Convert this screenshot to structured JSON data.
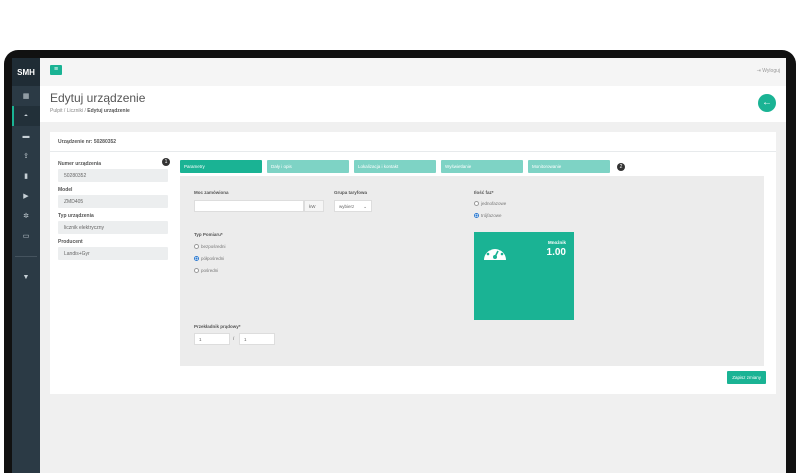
{
  "app": {
    "logo": "SMH"
  },
  "topbar": {
    "menu_icon": "≡",
    "logout_label": "Wyloguj"
  },
  "header": {
    "title": "Edytuj urządzenie",
    "breadcrumb": [
      "Pulpit",
      "Liczniki",
      "Edytuj urządzenie"
    ]
  },
  "panel": {
    "heading": "Urządzenie nr: 50280352"
  },
  "device": {
    "badge": "1",
    "fields": [
      {
        "label": "Numer urządzenia",
        "value": "50280352"
      },
      {
        "label": "Model",
        "value": "ZMD405"
      },
      {
        "label": "Typ urządzenia",
        "value": "licznik elektryczny"
      },
      {
        "label": "Producent",
        "value": "Landis+Gyr"
      }
    ]
  },
  "tabs": [
    {
      "label": "Parametry",
      "active": true
    },
    {
      "label": "Dały i opis",
      "active": false
    },
    {
      "label": "Lokalizacja i kontakt",
      "active": false
    },
    {
      "label": "Wyświetlanie",
      "active": false
    },
    {
      "label": "Monitorowanie",
      "active": false
    }
  ],
  "tabs_badge": "2",
  "form": {
    "power_label": "Moc zamówiona",
    "power_value": "",
    "power_unit": "kW",
    "tariff_label": "Grupa taryfowa",
    "tariff_selected": "wybierz",
    "phases_label": "Ilość faz*",
    "phases_options": [
      "jednofazowe",
      "trójfazowe"
    ],
    "phases_selected": 1,
    "measure_label": "Typ Pomiaru*",
    "measure_options": [
      "bezpośredni",
      "półpośredni",
      "pośredni"
    ],
    "measure_selected": 1,
    "ct_label": "Przekładnik prądowy*",
    "ct_num": "1",
    "ct_sep": "/",
    "ct_den": "1"
  },
  "meter": {
    "label": "Mnożnik",
    "value": "1.00"
  },
  "actions": {
    "save_label": "Zapisz zmiany"
  },
  "colors": {
    "accent": "#1ab394",
    "sidebar": "#2b3a45",
    "tab_inactive": "#7ed3c5"
  }
}
